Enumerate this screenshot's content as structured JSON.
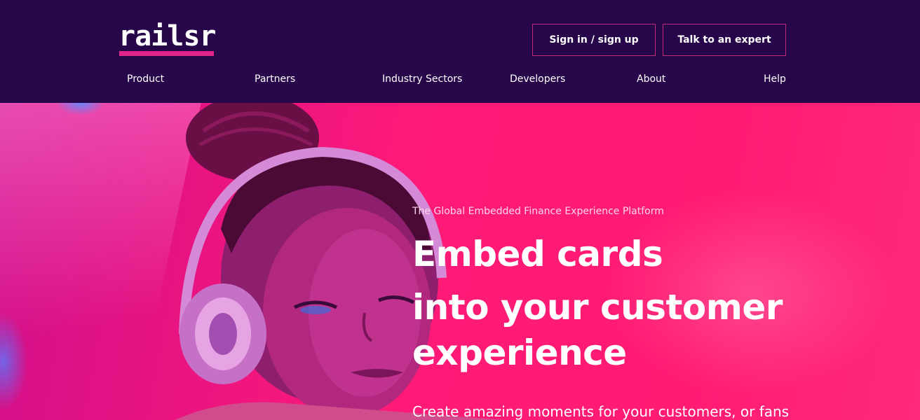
{
  "brand": {
    "logo_text": "railsr",
    "accent_color": "#e0248a",
    "header_bg": "#27064a",
    "hero_bg": "#ff1479"
  },
  "header": {
    "signin_label": "Sign in / sign up",
    "expert_label": "Talk to an expert"
  },
  "nav": {
    "items": [
      {
        "label": "Product"
      },
      {
        "label": "Partners"
      },
      {
        "label": "Industry Sectors"
      },
      {
        "label": "Developers"
      },
      {
        "label": "About"
      },
      {
        "label": "Help"
      }
    ]
  },
  "hero": {
    "eyebrow": "The Global Embedded Finance Experience Platform",
    "headline_line1": "Embed cards",
    "headline_line2": "into your customer",
    "headline_line3": "experience",
    "subline": "Create amazing moments for your customers, or fans",
    "image_subject": "woman-with-headphones-photo"
  }
}
